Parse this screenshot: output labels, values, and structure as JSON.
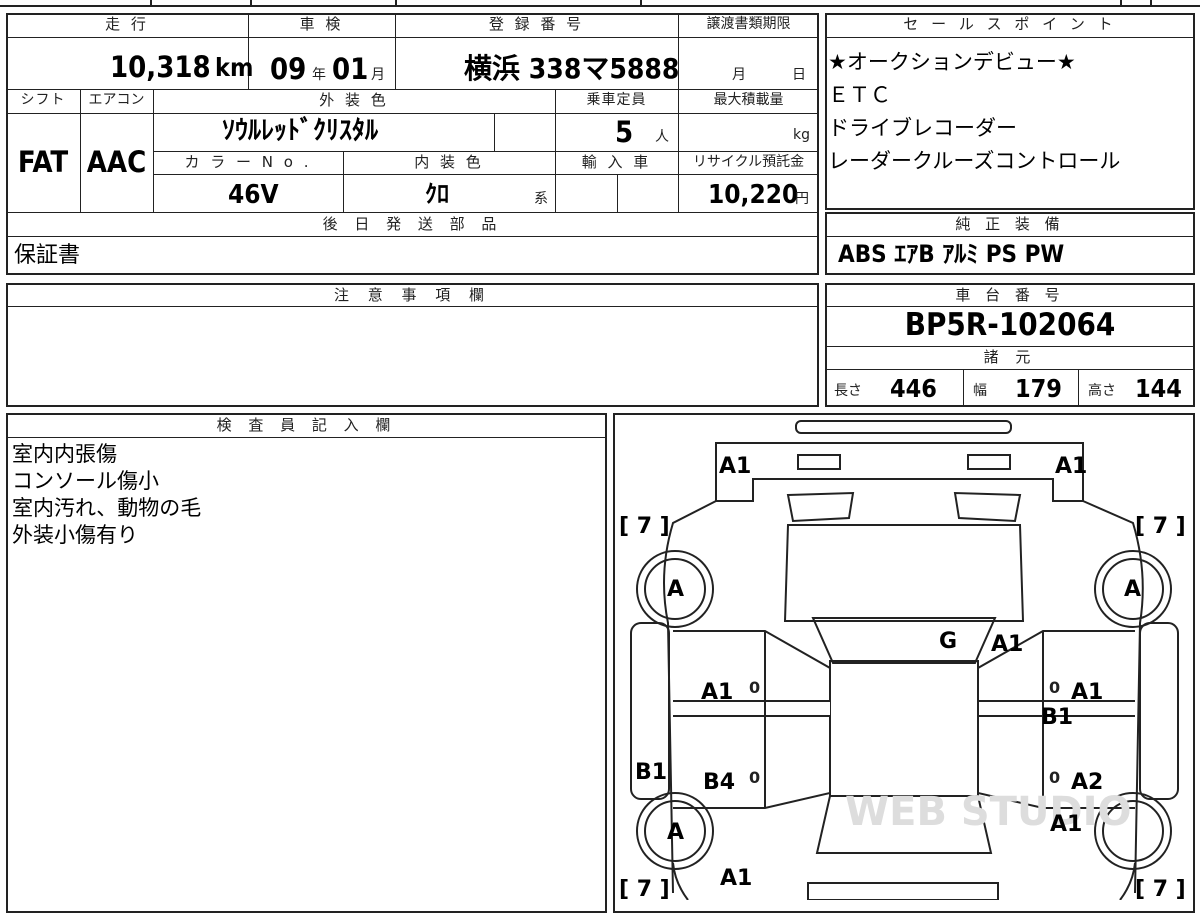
{
  "header_top": {
    "labels": {
      "mileage": "走 行",
      "inspection": "車 検",
      "registration": "登 録 番 号",
      "transfer_deadline": "譲渡書類期限",
      "shift": "シフト",
      "aircon": "エアコン",
      "exterior_color": "外 装 色",
      "capacity": "乗車定員",
      "max_load": "最大積載量",
      "color_no": "カ ラ ー N o .",
      "interior_color": "内 装 色",
      "import": "輸 入 車",
      "recycle": "リサイクル預託金",
      "later_parts": "後 日 発 送 部 品"
    },
    "mileage_value": "10,318",
    "mileage_unit": "km",
    "inspection_year": "09",
    "inspection_year_unit": "年",
    "inspection_month": "01",
    "inspection_month_unit": "月",
    "registration_number": "横浜 338マ5888",
    "deadline_month_unit": "月",
    "deadline_day_unit": "日",
    "shift_value": "FAT",
    "aircon_value": "AAC",
    "exterior_color_value": "ｿｳﾙﾚｯﾄﾞｸﾘｽﾀﾙ",
    "capacity_value": "5",
    "capacity_unit": "人",
    "max_load_unit": "kg",
    "color_no_value": "46V",
    "interior_color_value": "ｸﾛ",
    "interior_color_suffix": "系",
    "recycle_value": "10,220",
    "recycle_unit": "円",
    "later_parts_value": "保証書"
  },
  "sales_points": {
    "header": "セ ー ル ス ポ イ ン ト",
    "lines": [
      "★オークションデビュー★",
      "ＥＴＣ",
      "ドライブレコーダー",
      "レーダークルーズコントロール"
    ]
  },
  "genuine_equipment": {
    "header": "純 正 装 備",
    "value": "ABS ｴｱB ｱﾙﾐ PS PW"
  },
  "notes": {
    "header": "注 意 事 項 欄"
  },
  "chassis": {
    "header": "車 台 番 号",
    "value": "BP5R-102064"
  },
  "specs": {
    "header": "諸 元",
    "length_label": "長さ",
    "length_value": "446",
    "width_label": "幅",
    "width_value": "179",
    "height_label": "高さ",
    "height_value": "144"
  },
  "inspector": {
    "header": "検 査 員 記 入 欄",
    "lines": [
      "室内内張傷",
      "コンソール傷小",
      "室内汚れ、動物の毛",
      "外装小傷有り"
    ]
  },
  "damage_map": {
    "codes": {
      "front_left_corner": "A1",
      "front_right_corner": "A1",
      "tire_tread_fl": "[ 7 ]",
      "tire_tread_fr": "[ 7 ]",
      "tire_tread_rl": "[ 7 ]",
      "tire_tread_rr": "[ 7 ]",
      "wheel_fl": "A",
      "wheel_fr": "A",
      "wheel_rl": "A",
      "windshield": "G",
      "cowl_right": "A1",
      "front_door_left": "A1",
      "front_door_right": "A1",
      "pillar_right": "B1",
      "sill_left": "B1",
      "rear_door_left": "B4",
      "rear_door_right": "A2",
      "rear_fender_right": "A1",
      "rear_left": "A1",
      "door_zero_1": "0",
      "door_zero_2": "0",
      "door_zero_3": "0",
      "door_zero_4": "0"
    },
    "watermark": "WEB STUDIO"
  }
}
